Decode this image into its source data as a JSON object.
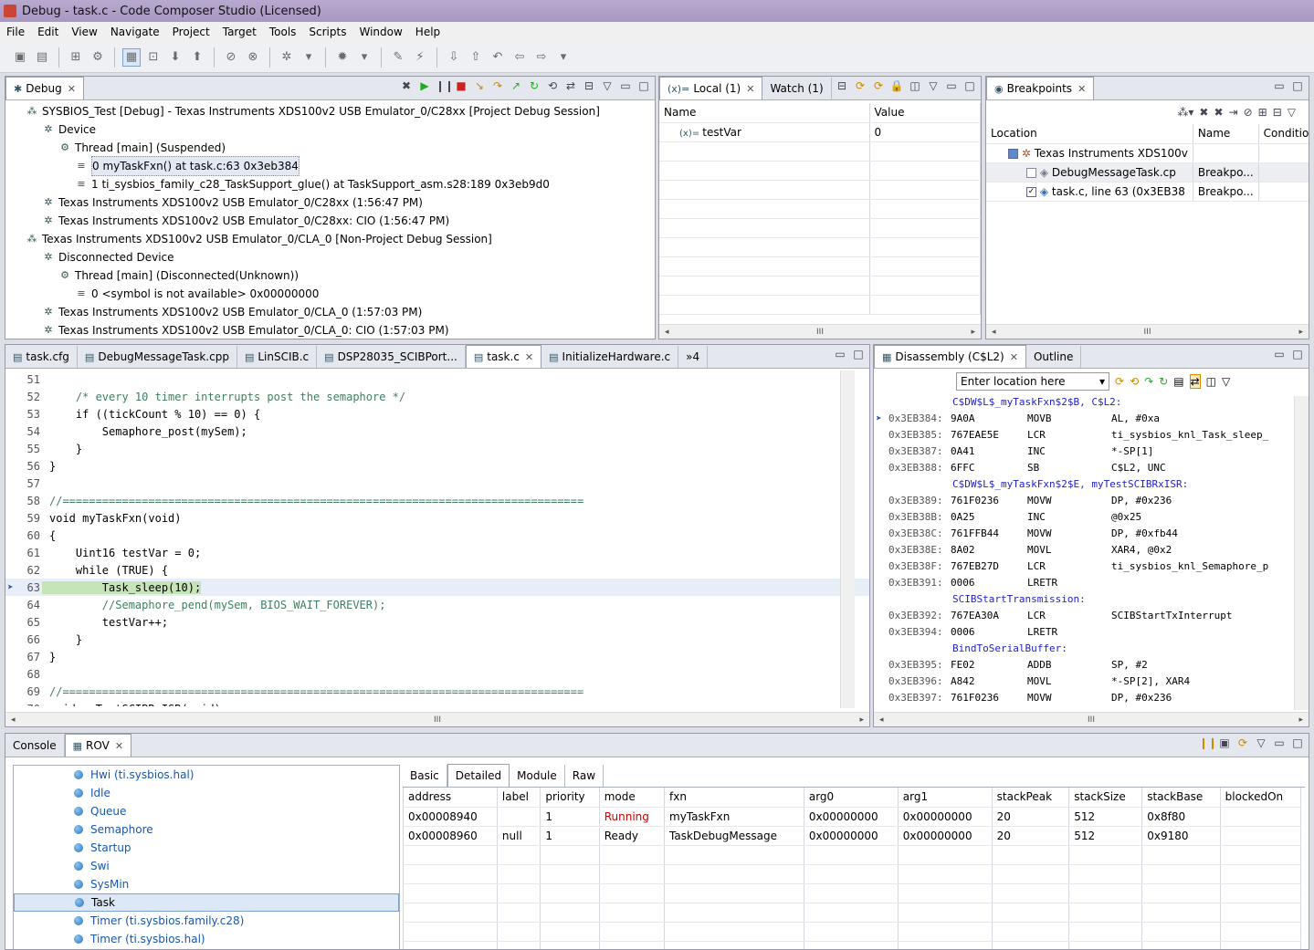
{
  "window": {
    "title": "Debug - task.c - Code Composer Studio (Licensed)"
  },
  "menu": [
    "File",
    "Edit",
    "View",
    "Navigate",
    "Project",
    "Target",
    "Tools",
    "Scripts",
    "Window",
    "Help"
  ],
  "debug": {
    "tab": "Debug",
    "rows": [
      {
        "indent": 0,
        "text": "SYSBIOS_Test [Debug] - Texas Instruments XDS100v2 USB Emulator_0/C28xx [Project Debug Session]"
      },
      {
        "indent": 1,
        "text": "Device"
      },
      {
        "indent": 2,
        "text": "Thread [main] (Suspended)"
      },
      {
        "indent": 3,
        "text": "0 myTaskFxn() at task.c:63 0x3eb384",
        "selected": true
      },
      {
        "indent": 3,
        "text": "1 ti_sysbios_family_c28_TaskSupport_glue() at TaskSupport_asm.s28:189 0x3eb9d0"
      },
      {
        "indent": 1,
        "text": "Texas Instruments XDS100v2 USB Emulator_0/C28xx (1:56:47 PM)"
      },
      {
        "indent": 1,
        "text": "Texas Instruments XDS100v2 USB Emulator_0/C28xx: CIO (1:56:47 PM)"
      },
      {
        "indent": 0,
        "text": "Texas Instruments XDS100v2 USB Emulator_0/CLA_0 [Non-Project Debug Session]"
      },
      {
        "indent": 1,
        "text": "Disconnected Device"
      },
      {
        "indent": 2,
        "text": "Thread [main] (Disconnected(Unknown))"
      },
      {
        "indent": 3,
        "text": "0 <symbol is not available> 0x00000000"
      },
      {
        "indent": 1,
        "text": "Texas Instruments XDS100v2 USB Emulator_0/CLA_0 (1:57:03 PM)"
      },
      {
        "indent": 1,
        "text": "Texas Instruments XDS100v2 USB Emulator_0/CLA_0: CIO (1:57:03 PM)"
      }
    ]
  },
  "vars": {
    "tab_local": "Local (1)",
    "tab_watch": "Watch (1)",
    "col_name": "Name",
    "col_value": "Value",
    "var_name": "testVar",
    "var_value": "0"
  },
  "breakpoints": {
    "tab": "Breakpoints",
    "col_location": "Location",
    "col_name": "Name",
    "col_condition": "Condition",
    "rows": [
      {
        "indent": 0,
        "location": "Texas Instruments XDS100v",
        "name": ""
      },
      {
        "indent": 1,
        "location": "DebugMessageTask.cp",
        "name": "Breakpo...",
        "checked": false
      },
      {
        "indent": 1,
        "location": "task.c, line 63 (0x3EB38",
        "name": "Breakpo...",
        "checked": true
      }
    ]
  },
  "editor": {
    "tabs": [
      "task.cfg",
      "DebugMessageTask.cpp",
      "LinSCIB.c",
      "DSP28035_SCIBPort...",
      "task.c",
      "InitializeHardware.c"
    ],
    "overflow": "»4",
    "lines": [
      {
        "n": "51",
        "t": ""
      },
      {
        "n": "52",
        "t": "    /* every 10 timer interrupts post the semaphore */",
        "c": "cm"
      },
      {
        "n": "53",
        "t": "    if ((tickCount % 10) == 0) {",
        "kw": "if"
      },
      {
        "n": "54",
        "t": "        Semaphore_post(mySem);"
      },
      {
        "n": "55",
        "t": "    }"
      },
      {
        "n": "56",
        "t": "}"
      },
      {
        "n": "57",
        "t": ""
      },
      {
        "n": "58",
        "t": "//===============================================================================",
        "c": "cm"
      },
      {
        "n": "59",
        "t": "void myTaskFxn(void)",
        "kw": "void"
      },
      {
        "n": "60",
        "t": "{"
      },
      {
        "n": "61",
        "t": "    Uint16 testVar = 0;"
      },
      {
        "n": "62",
        "t": "    while (TRUE) {",
        "kw": "while"
      },
      {
        "n": "63",
        "t": "        Task_sleep(10);",
        "hl": true
      },
      {
        "n": "64",
        "t": "        //Semaphore_pend(mySem, BIOS_WAIT_FOREVER);",
        "c": "cm"
      },
      {
        "n": "65",
        "t": "        testVar++;"
      },
      {
        "n": "66",
        "t": "    }"
      },
      {
        "n": "67",
        "t": "}"
      },
      {
        "n": "68",
        "t": ""
      },
      {
        "n": "69",
        "t": "//===============================================================================",
        "c": "cm"
      },
      {
        "n": "70",
        "t": "void myTestSCIBRxISR(void)",
        "kw": "void"
      }
    ]
  },
  "disasm": {
    "tab": "Disassembly (C$L2)",
    "tab_outline": "Outline",
    "location_placeholder": "Enter location here",
    "rows": [
      {
        "label": "C$DW$L$_myTaskFxn$2$B, C$L2:"
      },
      {
        "addr": "0x3EB384:",
        "op": "9A0A",
        "mn": "MOVB",
        "arg": "AL, #0xa",
        "cur": true
      },
      {
        "addr": "0x3EB385:",
        "op": "767EAE5E",
        "mn": "LCR",
        "arg": "ti_sysbios_knl_Task_sleep_"
      },
      {
        "addr": "0x3EB387:",
        "op": "0A41",
        "mn": "INC",
        "arg": "*-SP[1]"
      },
      {
        "addr": "0x3EB388:",
        "op": "6FFC",
        "mn": "SB",
        "arg": "C$L2, UNC"
      },
      {
        "label": "C$DW$L$_myTaskFxn$2$E, myTestSCIBRxISR:"
      },
      {
        "addr": "0x3EB389:",
        "op": "761F0236",
        "mn": "MOVW",
        "arg": "DP, #0x236"
      },
      {
        "addr": "0x3EB38B:",
        "op": "0A25",
        "mn": "INC",
        "arg": "@0x25"
      },
      {
        "addr": "0x3EB38C:",
        "op": "761FFB44",
        "mn": "MOVW",
        "arg": "DP, #0xfb44"
      },
      {
        "addr": "0x3EB38E:",
        "op": "8A02",
        "mn": "MOVL",
        "arg": "XAR4, @0x2"
      },
      {
        "addr": "0x3EB38F:",
        "op": "767EB27D",
        "mn": "LCR",
        "arg": "ti_sysbios_knl_Semaphore_p"
      },
      {
        "addr": "0x3EB391:",
        "op": "0006",
        "mn": "LRETR",
        "arg": ""
      },
      {
        "label": "SCIBStartTransmission:"
      },
      {
        "addr": "0x3EB392:",
        "op": "767EA30A",
        "mn": "LCR",
        "arg": "SCIBStartTxInterrupt"
      },
      {
        "addr": "0x3EB394:",
        "op": "0006",
        "mn": "LRETR",
        "arg": ""
      },
      {
        "label": "BindToSerialBuffer:"
      },
      {
        "addr": "0x3EB395:",
        "op": "FE02",
        "mn": "ADDB",
        "arg": "SP, #2"
      },
      {
        "addr": "0x3EB396:",
        "op": "A842",
        "mn": "MOVL",
        "arg": "*-SP[2], XAR4"
      },
      {
        "addr": "0x3EB397:",
        "op": "761F0236",
        "mn": "MOVW",
        "arg": "DP, #0x236"
      }
    ]
  },
  "bottom": {
    "tab_console": "Console",
    "tab_rov": "ROV",
    "modules": [
      {
        "name": "Hwi (ti.sysbios.hal)"
      },
      {
        "name": "Idle"
      },
      {
        "name": "Queue"
      },
      {
        "name": "Semaphore"
      },
      {
        "name": "Startup"
      },
      {
        "name": "Swi"
      },
      {
        "name": "SysMin"
      },
      {
        "name": "Task",
        "selected": true
      },
      {
        "name": "Timer (ti.sysbios.family.c28)"
      },
      {
        "name": "Timer (ti.sysbios.hal)"
      }
    ],
    "subtabs": [
      "Basic",
      "Detailed",
      "Module",
      "Raw"
    ],
    "columns": [
      "address",
      "label",
      "priority",
      "mode",
      "fxn",
      "arg0",
      "arg1",
      "stackPeak",
      "stackSize",
      "stackBase",
      "blockedOn"
    ],
    "rows": [
      [
        "0x00008940",
        "",
        "1",
        "Running",
        "myTaskFxn",
        "0x00000000",
        "0x00000000",
        "20",
        "512",
        "0x8f80",
        ""
      ],
      [
        "0x00008960",
        "null",
        "1",
        "Ready",
        "TaskDebugMessage",
        "0x00000000",
        "0x00000000",
        "20",
        "512",
        "0x9180",
        ""
      ]
    ],
    "running_color": "#cc0000"
  }
}
